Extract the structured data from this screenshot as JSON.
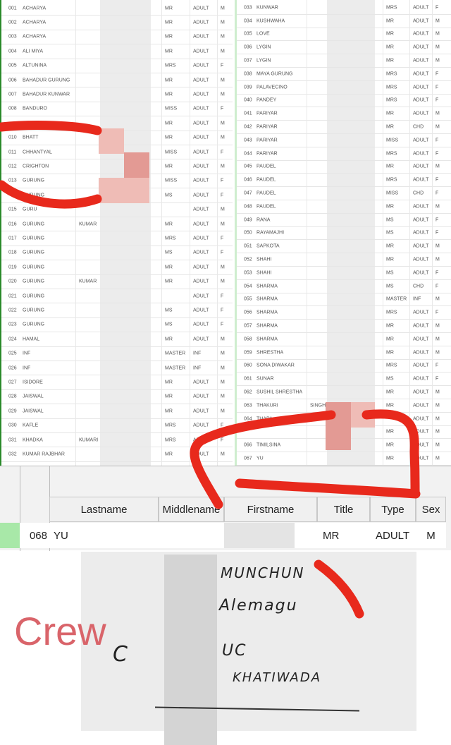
{
  "left_table": {
    "rows": [
      [
        "001",
        "ACHARYA",
        "",
        "MR",
        "ADULT",
        "M"
      ],
      [
        "002",
        "ACHARYA",
        "",
        "MR",
        "ADULT",
        "M"
      ],
      [
        "003",
        "ACHARYA",
        "",
        "MR",
        "ADULT",
        "M"
      ],
      [
        "004",
        "ALI MIYA",
        "",
        "MR",
        "ADULT",
        "M"
      ],
      [
        "005",
        "ALTUNINA",
        "",
        "MRS",
        "ADULT",
        "F"
      ],
      [
        "006",
        "BAHADUR GURUNG",
        "",
        "MR",
        "ADULT",
        "M"
      ],
      [
        "007",
        "BAHADUR KUNWAR",
        "",
        "MR",
        "ADULT",
        "M"
      ],
      [
        "008",
        "BANDURO",
        "",
        "MISS",
        "ADULT",
        "F"
      ],
      [
        "",
        "",
        "",
        "MR",
        "ADULT",
        "M"
      ],
      [
        "010",
        "BHATT",
        "",
        "MR",
        "ADULT",
        "M"
      ],
      [
        "011",
        "CHHANTYAL",
        "",
        "MISS",
        "ADULT",
        "F"
      ],
      [
        "012",
        "CRIGHTON",
        "",
        "MR",
        "ADULT",
        "M"
      ],
      [
        "013",
        "GURUNG",
        "",
        "MISS",
        "ADULT",
        "F"
      ],
      [
        "",
        "GURUNG",
        "",
        "MS",
        "ADULT",
        "F"
      ],
      [
        "015",
        "GURU",
        "",
        "",
        "ADULT",
        "M"
      ],
      [
        "016",
        "GURUNG",
        "KUMAR",
        "MR",
        "ADULT",
        "M"
      ],
      [
        "017",
        "GURUNG",
        "",
        "MRS",
        "ADULT",
        "F"
      ],
      [
        "018",
        "GURUNG",
        "",
        "MS",
        "ADULT",
        "F"
      ],
      [
        "019",
        "GURUNG",
        "",
        "MR",
        "ADULT",
        "M"
      ],
      [
        "020",
        "GURUNG",
        "KUMAR",
        "MR",
        "ADULT",
        "M"
      ],
      [
        "021",
        "GURUNG",
        "",
        "",
        "ADULT",
        "F"
      ],
      [
        "022",
        "GURUNG",
        "",
        "MS",
        "ADULT",
        "F"
      ],
      [
        "023",
        "GURUNG",
        "",
        "MS",
        "ADULT",
        "F"
      ],
      [
        "024",
        "HAMAL",
        "",
        "MR",
        "ADULT",
        "M"
      ],
      [
        "025",
        "INF",
        "",
        "MASTER",
        "INF",
        "M"
      ],
      [
        "026",
        "INF",
        "",
        "MASTER",
        "INF",
        "M"
      ],
      [
        "027",
        "ISIDORE",
        "",
        "MR",
        "ADULT",
        "M"
      ],
      [
        "028",
        "JAISWAL",
        "",
        "MR",
        "ADULT",
        "M"
      ],
      [
        "029",
        "JAISWAL",
        "",
        "MR",
        "ADULT",
        "M"
      ],
      [
        "030",
        "KAFLE",
        "",
        "MRS",
        "ADULT",
        "F"
      ],
      [
        "031",
        "KHADKA",
        "KUMARI",
        "MRS",
        "ADULT",
        "F"
      ],
      [
        "032",
        "KUMAR RAJBHAR",
        "",
        "MR",
        "ADULT",
        "M"
      ]
    ]
  },
  "right_table": {
    "rows": [
      [
        "033",
        "KUNWAR",
        "",
        "MRS",
        "ADULT",
        "F"
      ],
      [
        "034",
        "KUSHWAHA",
        "",
        "MR",
        "ADULT",
        "M"
      ],
      [
        "035",
        "LOVE",
        "",
        "MR",
        "ADULT",
        "M"
      ],
      [
        "036",
        "LYGIN",
        "",
        "MR",
        "ADULT",
        "M"
      ],
      [
        "037",
        "LYGIN",
        "",
        "MR",
        "ADULT",
        "M"
      ],
      [
        "038",
        "MAYA GURUNG",
        "",
        "MRS",
        "ADULT",
        "F"
      ],
      [
        "039",
        "PALAVECINO",
        "",
        "MRS",
        "ADULT",
        "F"
      ],
      [
        "040",
        "PANDEY",
        "",
        "MRS",
        "ADULT",
        "F"
      ],
      [
        "041",
        "PARIYAR",
        "",
        "MR",
        "ADULT",
        "M"
      ],
      [
        "042",
        "PARIYAR",
        "",
        "MR",
        "CHD",
        "M"
      ],
      [
        "043",
        "PARIYAR",
        "",
        "MISS",
        "ADULT",
        "F"
      ],
      [
        "044",
        "PARIYAR",
        "",
        "MRS",
        "ADULT",
        "F"
      ],
      [
        "045",
        "PAUDEL",
        "",
        "MR",
        "ADULT",
        "M"
      ],
      [
        "046",
        "PAUDEL",
        "",
        "MRS",
        "ADULT",
        "F"
      ],
      [
        "047",
        "PAUDEL",
        "",
        "MISS",
        "CHD",
        "F"
      ],
      [
        "048",
        "PAUDEL",
        "",
        "MR",
        "ADULT",
        "M"
      ],
      [
        "049",
        "RANA",
        "",
        "MS",
        "ADULT",
        "F"
      ],
      [
        "050",
        "RAYAMAJHI",
        "",
        "MS",
        "ADULT",
        "F"
      ],
      [
        "051",
        "SAPKOTA",
        "",
        "MR",
        "ADULT",
        "M"
      ],
      [
        "052",
        "SHAHI",
        "",
        "MR",
        "ADULT",
        "M"
      ],
      [
        "053",
        "SHAHI",
        "",
        "MS",
        "ADULT",
        "F"
      ],
      [
        "054",
        "SHARMA",
        "",
        "MS",
        "CHD",
        "F"
      ],
      [
        "055",
        "SHARMA",
        "",
        "MASTER",
        "INF",
        "M"
      ],
      [
        "056",
        "SHARMA",
        "",
        "MRS",
        "ADULT",
        "F"
      ],
      [
        "057",
        "SHARMA",
        "",
        "MR",
        "ADULT",
        "M"
      ],
      [
        "058",
        "SHARMA",
        "",
        "MR",
        "ADULT",
        "M"
      ],
      [
        "059",
        "SHRESTHA",
        "",
        "MR",
        "ADULT",
        "M"
      ],
      [
        "060",
        "SONA DIWAKAR",
        "",
        "MRS",
        "ADULT",
        "F"
      ],
      [
        "061",
        "SUNAR",
        "",
        "MS",
        "ADULT",
        "F"
      ],
      [
        "062",
        "SUSHIL SHRESTHA",
        "",
        "MR",
        "ADULT",
        "M"
      ],
      [
        "063",
        "THAKURI",
        "SINGH",
        "MR",
        "ADULT",
        "M"
      ],
      [
        "064",
        "THAPA",
        "",
        "",
        "ADULT",
        "M"
      ],
      [
        "",
        "",
        "",
        "MR",
        "ADULT",
        "M"
      ],
      [
        "066",
        "TIMILSINA",
        "",
        "MR",
        "ADULT",
        "M"
      ],
      [
        "067",
        "YU",
        "",
        "MR",
        "ADULT",
        "M"
      ]
    ]
  },
  "grid": {
    "headers": {
      "lastname": "Lastname",
      "middlename": "Middlename",
      "firstname": "Firstname",
      "title": "Title",
      "type": "Type",
      "sex": "Sex"
    },
    "row": {
      "num": "068",
      "lastname": "YU",
      "middlename": "",
      "title": "MR",
      "type": "ADULT",
      "sex": "M"
    }
  },
  "crew": {
    "label": "Crew",
    "label_color": "#d9646a",
    "handwriting": [
      "MUNCHUN",
      "Alemagu",
      "C",
      "UC",
      "KHATIWADA"
    ]
  },
  "annotation_color": "#e8291c"
}
